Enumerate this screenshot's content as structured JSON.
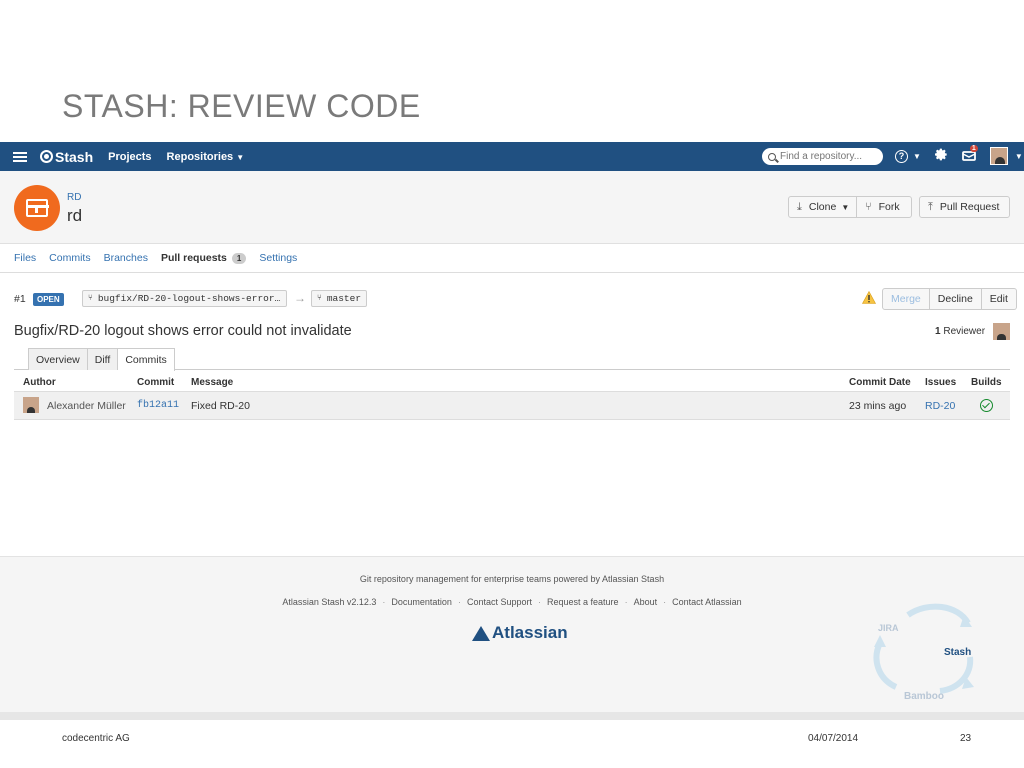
{
  "slide": {
    "title": "STASH: REVIEW CODE",
    "company": "codecentric AG",
    "date": "04/07/2014",
    "page": "23"
  },
  "topnav": {
    "brand": "Stash",
    "projects": "Projects",
    "repositories": "Repositories",
    "search_placeholder": "Find a repository...",
    "help": "?",
    "notifications": "1",
    "icons": [
      "menu-icon",
      "help-icon",
      "gear-icon",
      "notification-icon",
      "user-avatar"
    ]
  },
  "repo": {
    "project": "RD",
    "name": "rd",
    "actions": {
      "clone": "Clone",
      "fork": "Fork",
      "pull_request": "Pull Request"
    },
    "tabs": {
      "files": "Files",
      "commits": "Commits",
      "branches": "Branches",
      "pull_requests": "Pull requests",
      "pull_requests_count": "1",
      "settings": "Settings"
    }
  },
  "pull_request": {
    "id": "#1",
    "state": "OPEN",
    "source_branch": "bugfix/RD-20-logout-shows-error…",
    "target_branch": "master",
    "title": "Bugfix/RD-20 logout shows error could not invalidate",
    "reviewer_count": "1",
    "reviewer_label": "Reviewer",
    "actions": {
      "merge": "Merge",
      "decline": "Decline",
      "edit": "Edit"
    },
    "tabs": {
      "overview": "Overview",
      "diff": "Diff",
      "commits": "Commits"
    }
  },
  "commits_table": {
    "headers": {
      "author": "Author",
      "commit": "Commit",
      "message": "Message",
      "commit_date": "Commit Date",
      "issues": "Issues",
      "builds": "Builds"
    },
    "rows": [
      {
        "author": "Alexander Müller",
        "commit": "fb12a11",
        "message": "Fixed RD-20",
        "commit_date": "23 mins ago",
        "issue": "RD-20",
        "build": "success"
      }
    ]
  },
  "footer": {
    "tagline": "Git repository management for enterprise teams powered by Atlassian Stash",
    "links": {
      "version": "Atlassian Stash v2.12.3",
      "documentation": "Documentation",
      "contact_support": "Contact Support",
      "request_feature": "Request a feature",
      "about": "About",
      "contact_atlassian": "Contact Atlassian"
    },
    "separator": "·",
    "logo": "Atlassian",
    "cycle": {
      "jira": "JIRA",
      "stash": "Stash",
      "bamboo": "Bamboo"
    }
  },
  "colors": {
    "nav": "#205081",
    "link": "#3572b0",
    "repo_avatar": "#f06a1e",
    "open_badge": "#3572b0",
    "build_ok": "#14892c"
  }
}
